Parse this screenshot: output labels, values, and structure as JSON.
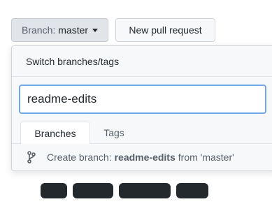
{
  "toolbar": {
    "branch_prefix": "Branch:",
    "branch_name": "master",
    "new_pr_label": "New pull request"
  },
  "dropdown": {
    "title": "Switch branches/tags",
    "filter_value": "readme-edits",
    "tabs": [
      {
        "label": "Branches",
        "active": true
      },
      {
        "label": "Tags",
        "active": false
      }
    ],
    "create": {
      "label": "Create branch:",
      "new_branch": "readme-edits",
      "from_text": "from 'master'",
      "icon": "git-branch-icon"
    }
  },
  "colors": {
    "accent_border": "#6ea8e8",
    "button_bg": "#e1e4e8",
    "panel_bg": "#f6f8fa"
  }
}
